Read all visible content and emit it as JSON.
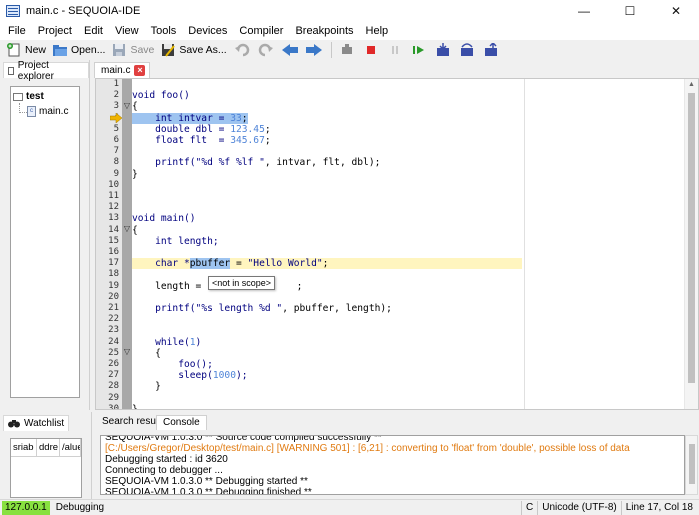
{
  "window": {
    "title": "main.c - SEQUOIA-IDE",
    "controls": [
      "—",
      "☐",
      "✕"
    ]
  },
  "menu": [
    "File",
    "Project",
    "Edit",
    "View",
    "Tools",
    "Devices",
    "Compiler",
    "Breakpoints",
    "Help"
  ],
  "toolbar": {
    "new_label": "New",
    "open_label": "Open...",
    "save_label": "Save",
    "saveas_label": "Save As..."
  },
  "project_explorer": {
    "tab_label": "Project explorer",
    "root": "test",
    "files": [
      "main.c"
    ]
  },
  "editor": {
    "tab_label": "main.c",
    "tooltip": "<not in scope>",
    "current_line": 4,
    "highlight_line": 17,
    "lines": [
      {
        "n": "1"
      },
      {
        "n": "2"
      },
      {
        "n": "3"
      },
      {
        "n": "4"
      },
      {
        "n": "5"
      },
      {
        "n": "6"
      },
      {
        "n": "7"
      },
      {
        "n": "8"
      },
      {
        "n": "9"
      },
      {
        "n": "10"
      },
      {
        "n": "11"
      },
      {
        "n": "12"
      },
      {
        "n": "13"
      },
      {
        "n": "14"
      },
      {
        "n": "15"
      },
      {
        "n": "16"
      },
      {
        "n": "17"
      },
      {
        "n": "18"
      },
      {
        "n": "19"
      },
      {
        "n": "20"
      },
      {
        "n": "21"
      },
      {
        "n": "22"
      },
      {
        "n": "23"
      },
      {
        "n": "24"
      },
      {
        "n": "25"
      },
      {
        "n": "26"
      },
      {
        "n": "27"
      },
      {
        "n": "28"
      },
      {
        "n": "29"
      },
      {
        "n": "30"
      }
    ],
    "code": {
      "l2": "void foo()",
      "l3": "{",
      "l4_a": "    int intvar = ",
      "l4_b": "33",
      "l4_c": ";",
      "l5_a": "    double dbl = ",
      "l5_b": "123.45",
      "l5_c": ";",
      "l6_a": "    float flt  = ",
      "l6_b": "345.67",
      "l6_c": ";",
      "l8_a": "    printf(",
      "l8_b": "\"%d %f %lf \"",
      "l8_c": ", intvar, flt, dbl);",
      "l9": "}",
      "l13": "void main()",
      "l14": "{",
      "l15": "    int length;",
      "l17_a": "    char *",
      "l17_b": "pbuffer",
      "l17_c": " = ",
      "l17_d": "\"Hello World\"",
      "l17_e": ";",
      "l19_a": "    length = st",
      "l19_b": ";",
      "l21_a": "    printf(",
      "l21_b": "\"%s length %d \"",
      "l21_c": ", pbuffer, length);",
      "l24_a": "    while(",
      "l24_b": "1",
      "l24_c": ")",
      "l25": "    {",
      "l26": "        foo();",
      "l27_a": "        sleep(",
      "l27_b": "1000",
      "l27_c": ");",
      "l28": "    }",
      "l30": "}"
    }
  },
  "watchlist": {
    "tab_label": "Watchlist",
    "columns": [
      "sriab",
      "ddre",
      "/alue"
    ]
  },
  "bottom_tabs": [
    "Search result",
    "Console"
  ],
  "console": {
    "lines": [
      {
        "text": "SEQUOIA-VM 1.0.3.0 ** Source code compiled successfully **",
        "type": "normal"
      },
      {
        "text": "[C:/Users/Gregor/Desktop/test/main.c] [WARNING 501] : [6,21] : converting to 'float' from 'double', possible loss of data",
        "type": "warn"
      },
      {
        "text": "Debugging started : id 3620",
        "type": "normal"
      },
      {
        "text": "Connecting to debugger ...",
        "type": "normal"
      },
      {
        "text": "SEQUOIA-VM 1.0.3.0 ** Debugging started **",
        "type": "normal"
      },
      {
        "text": "SEQUOIA-VM 1.0.3.0 ** Debugging finished **",
        "type": "normal"
      }
    ]
  },
  "status": {
    "ip": "127.0.0.1",
    "state": "Debugging",
    "lang": "C",
    "encoding": "Unicode (UTF-8)",
    "position": "Line 17, Col 18"
  },
  "colors": {
    "keyword": "#00007f",
    "number": "#4f84d8",
    "current_line_bg": "#fff5bf",
    "selection": "#9ec4f0",
    "warning": "#e07a10",
    "status_ip_bg": "#88e040"
  }
}
